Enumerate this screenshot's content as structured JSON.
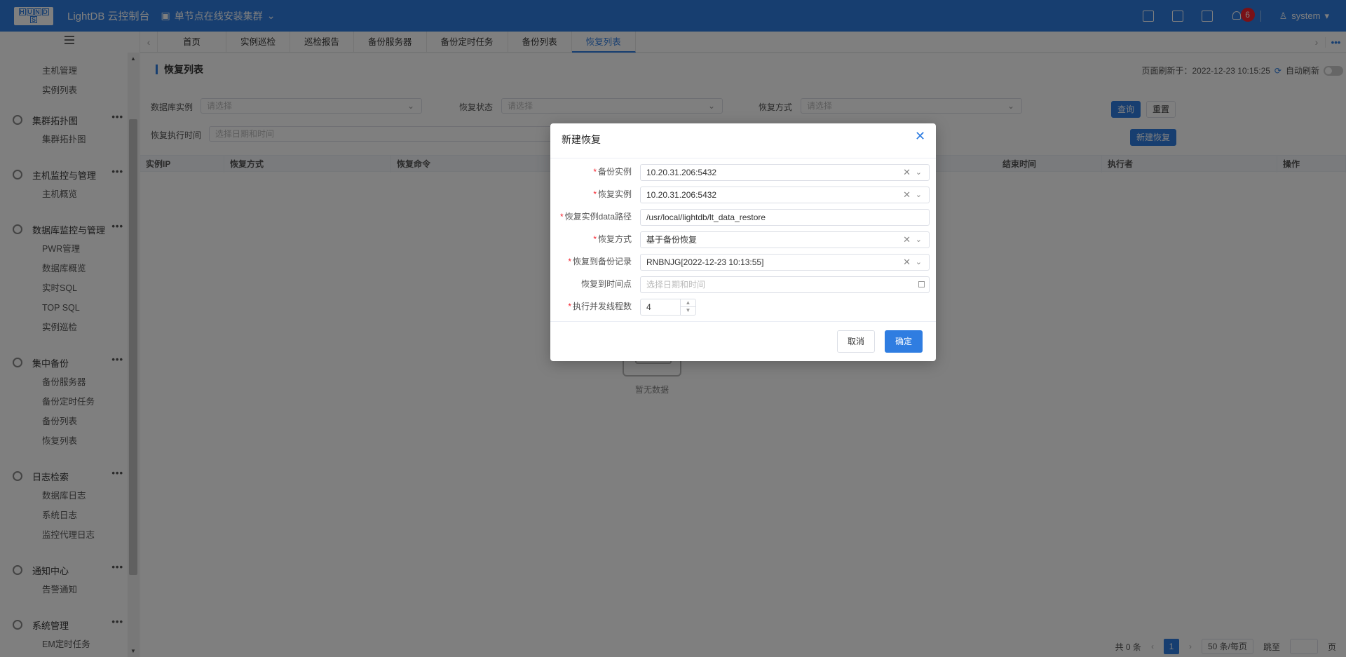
{
  "header": {
    "app_title": "LightDB 云控制台",
    "cluster_name": "单节点在线安装集群",
    "notification_count": "6",
    "user": "system"
  },
  "sidebar": {
    "groups": [
      {
        "items": [
          "主机管理",
          "实例列表"
        ]
      },
      {
        "title": "集群拓扑图",
        "items": [
          "集群拓扑图"
        ]
      },
      {
        "title": "主机监控与管理",
        "items": [
          "主机概览"
        ]
      },
      {
        "title": "数据库监控与管理",
        "items": [
          "PWR管理",
          "数据库概览",
          "实时SQL",
          "TOP SQL",
          "实例巡检"
        ]
      },
      {
        "title": "集中备份",
        "items": [
          "备份服务器",
          "备份定时任务",
          "备份列表",
          "恢复列表"
        ]
      },
      {
        "title": "日志检索",
        "items": [
          "数据库日志",
          "系统日志",
          "监控代理日志"
        ]
      },
      {
        "title": "通知中心",
        "items": [
          "告警通知"
        ]
      },
      {
        "title": "系统管理",
        "items": [
          "EM定时任务"
        ]
      }
    ]
  },
  "tabs": [
    "首页",
    "实例巡检",
    "巡检报告",
    "备份服务器",
    "备份定时任务",
    "备份列表",
    "恢复列表"
  ],
  "main": {
    "title": "恢复列表",
    "refresh_text": "页面刷新于：2022-12-23 10:15:25",
    "auto_refresh": "自动刷新",
    "filters": {
      "db_instance": "数据库实例",
      "restore_status": "恢复状态",
      "restore_method": "恢复方式",
      "restore_time": "恢复执行时间",
      "placeholder": "请选择",
      "date_placeholder": "选择日期和时间"
    },
    "buttons": {
      "query": "查询",
      "reset": "重置",
      "new_restore": "新建恢复"
    },
    "columns": [
      "实例IP",
      "恢复方式",
      "恢复命令",
      "结束时间",
      "执行者",
      "操作"
    ],
    "empty_text": "暂无数据",
    "pager": {
      "total": "共 0 条",
      "page": "1",
      "page_size": "50 条/每页",
      "jump": "跳至",
      "page_unit": "页"
    }
  },
  "modal": {
    "title": "新建恢复",
    "fields": [
      {
        "label": "备份实例",
        "value": "10.20.31.206:5432",
        "required": true
      },
      {
        "label": "恢复实例",
        "value": "10.20.31.206:5432",
        "required": true
      },
      {
        "label": "恢复实例data路径",
        "value": "/usr/local/lightdb/lt_data_restore",
        "required": true
      },
      {
        "label": "恢复方式",
        "value": "基于备份恢复",
        "required": true
      },
      {
        "label": "恢复到备份记录",
        "value": "RNBNJG[2022-12-23 10:13:55]",
        "required": true
      },
      {
        "label": "恢复到时间点",
        "placeholder": "选择日期和时间",
        "required": false
      },
      {
        "label": "执行并发线程数",
        "value": "4",
        "required": true
      }
    ],
    "cancel": "取消",
    "confirm": "确定"
  },
  "colors": {
    "primary": "#2f7de1",
    "badge": "#f5222d"
  },
  "icons": [
    "menu-collapse-icon",
    "monitor-icon",
    "chevron-down-icon",
    "report-icon",
    "terminal-icon",
    "package-icon",
    "bell-icon",
    "user-icon",
    "gear-icon",
    "close-icon",
    "calendar-icon",
    "empty-inbox-icon",
    "clear-icon"
  ]
}
